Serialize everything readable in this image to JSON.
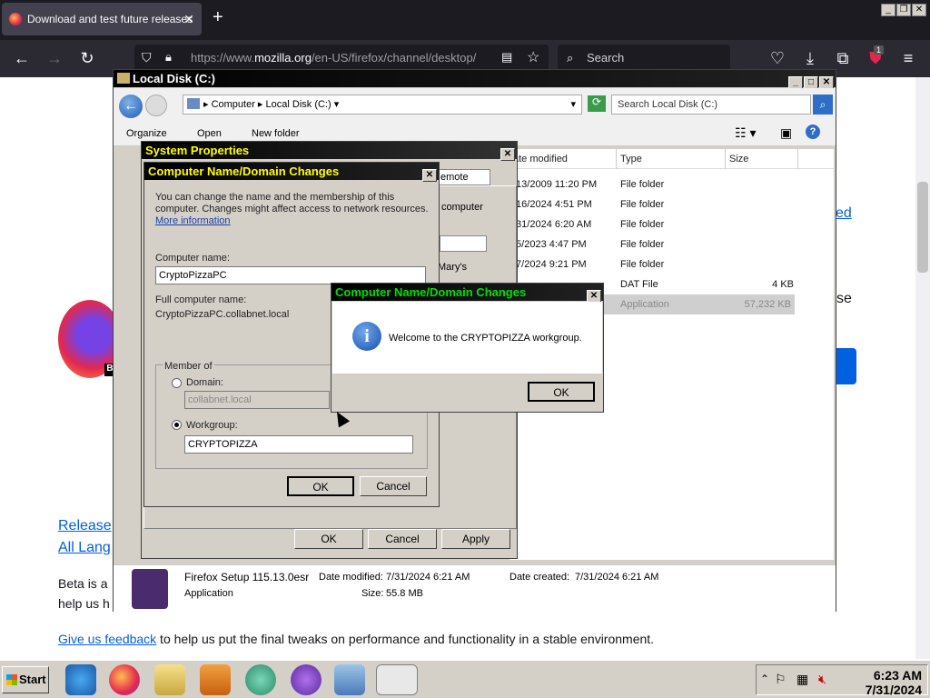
{
  "browser": {
    "tab_title": "Download and test future releases",
    "tab_close": "✕",
    "new_tab": "+",
    "url_prefix": "https://www.",
    "url_domain": "mozilla.org",
    "url_path": "/en-US/firefox/channel/desktop/",
    "search_placeholder": "Search",
    "extension_badge": "1"
  },
  "webpage": {
    "link_release": "Release",
    "link_all_lang": "All Lang",
    "beta_text_1": "Beta is a",
    "beta_text_2": "help us h",
    "feedback_link": "Give us feedback",
    "feedback_text": " to help us put the final tweaks on performance and functionality in a stable environment.",
    "partial_link": "ed",
    "partial_text": "se"
  },
  "explorer": {
    "title": "Local Disk (C:)",
    "breadcrumb": [
      "Computer",
      "Local Disk (C:)"
    ],
    "search_placeholder": "Search Local Disk (C:)",
    "toolbar": {
      "organize": "Organize",
      "open": "Open",
      "new_folder": "New folder"
    },
    "columns": [
      "ate modified",
      "Type",
      "Size"
    ],
    "files": [
      {
        "date": "/13/2009 11:20 PM",
        "type": "File folder",
        "size": ""
      },
      {
        "date": "/16/2024 4:51 PM",
        "type": "File folder",
        "size": ""
      },
      {
        "date": "/31/2024 6:20 AM",
        "type": "File folder",
        "size": ""
      },
      {
        "date": "/5/2023 4:47 PM",
        "type": "File folder",
        "size": ""
      },
      {
        "date": "/7/2024 9:21 PM",
        "type": "File folder",
        "size": ""
      },
      {
        "date": "",
        "type": "DAT File",
        "size": "4 KB"
      },
      {
        "date": "",
        "type": "Application",
        "size": "57,232 KB"
      }
    ],
    "details": {
      "name": "Firefox Setup 115.13.0esr",
      "kind": "Application",
      "modified_label": "Date modified:",
      "modified": "7/31/2024 6:21 AM",
      "created_label": "Date created:",
      "created": "7/31/2024 6:21 AM",
      "size_label": "Size:",
      "size": "55.8 MB"
    }
  },
  "system_properties": {
    "title": "System Properties",
    "tab_remote": "emote",
    "bg_text_1": "computer",
    "bg_text_2": "Mary's",
    "ok": "OK",
    "cancel": "Cancel",
    "apply": "Apply"
  },
  "name_dialog": {
    "title": "Computer Name/Domain Changes",
    "intro_1": "You can change the name and the membership of this",
    "intro_2": "computer. Changes might affect access to network resources.",
    "more_info": "More information",
    "computer_name_label": "Computer name:",
    "computer_name": "CryptoPizzaPC",
    "full_name_label": "Full computer name:",
    "full_name": "CryptoPizzaPC.collabnet.local",
    "member_of": "Member of",
    "domain_label": "Domain:",
    "domain_value": "collabnet.local",
    "workgroup_label": "Workgroup:",
    "workgroup_value": "CRYPTOPIZZA",
    "ok": "OK",
    "cancel": "Cancel"
  },
  "welcome_dialog": {
    "title": "Computer Name/Domain Changes",
    "message": "Welcome to the CRYPTOPIZZA workgroup.",
    "ok": "OK"
  },
  "taskbar": {
    "start": "Start",
    "time": "6:23 AM",
    "date": "7/31/2024"
  }
}
